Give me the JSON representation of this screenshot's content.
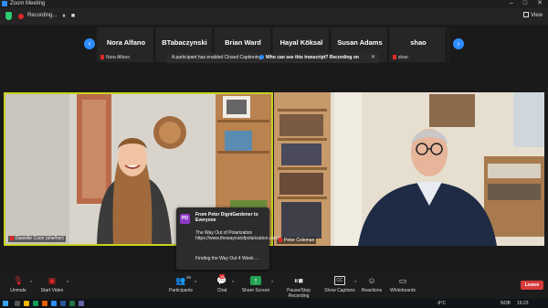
{
  "window": {
    "title": "Zoom Meeting",
    "controls": [
      "–",
      "□",
      "✕"
    ]
  },
  "topbar": {
    "recording_label": "Recording...",
    "pause": "⏸",
    "stop": "■",
    "view_label": "View"
  },
  "participants_strip": [
    {
      "name": "Nora Alfano",
      "sub": "Nora Alfano"
    },
    {
      "name": "BTabaczynski",
      "sub": ""
    },
    {
      "name": "Brian Ward",
      "sub": ""
    },
    {
      "name": "Hayal Köksal",
      "sub": ""
    },
    {
      "name": "Susan Adams",
      "sub": ""
    },
    {
      "name": "shao",
      "sub": "shao"
    }
  ],
  "captions_notice": {
    "text": "A participant has enabled Closed Captioning",
    "question": "Who can see this transcript? Recording on",
    "close": "✕"
  },
  "videos": {
    "left": {
      "name": "Danielle Coon (she/her)"
    },
    "right": {
      "name": "Peter Coleman"
    }
  },
  "chat_popup": {
    "avatar": "PD",
    "header": "From Peter DigniGardener to Everyone",
    "message": "The Way Out of Polarization https://www.thewayoutofpolarization.com/",
    "message2": "Finding the Way Out 4 Week ..."
  },
  "toolbar": {
    "unmute": "Unmute",
    "start_video": "Start Video",
    "participants": "Participants",
    "participants_count": "40",
    "chat": "Chat",
    "chat_badge": "18",
    "share_screen": "Share Screen",
    "pause_recording": "Pause/Stop Recording",
    "captions": "Show Captions",
    "reactions": "Reactions",
    "whiteboards": "Whiteboards",
    "leave": "Leave"
  },
  "taskbar": {
    "weather": "-9°C",
    "lang": "NOB",
    "time": "19:23"
  }
}
